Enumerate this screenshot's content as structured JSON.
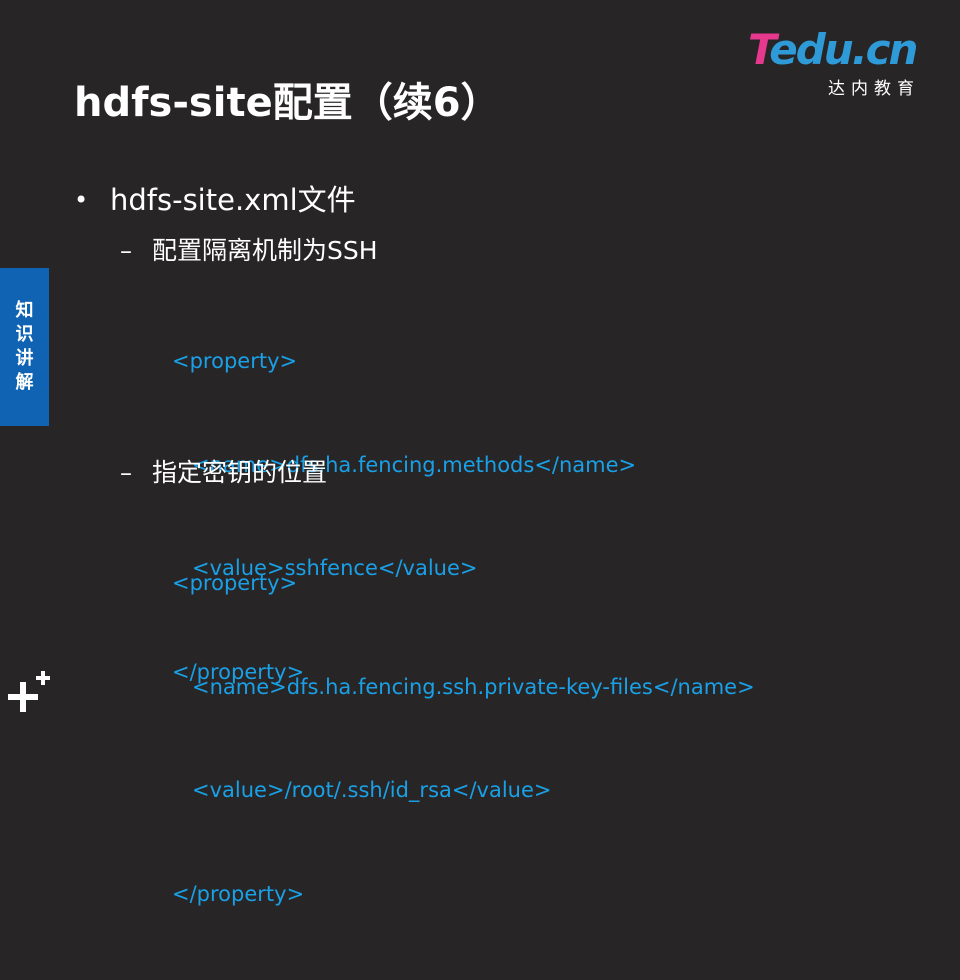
{
  "slide": {
    "title": "hdfs-site配置（续6）",
    "logo": {
      "brand_first": "T",
      "brand_rest": "edu.cn",
      "subtitle": "达内教育"
    },
    "side_tab": {
      "chars": [
        "知",
        "识",
        "讲",
        "解"
      ]
    },
    "bullet": {
      "marker": "•",
      "text": "hdfs-site.xml文件"
    },
    "sections": [
      {
        "dash": "–",
        "heading": "配置隔离机制为SSH",
        "code_lines": [
          "<property>",
          "   <name>dfs.ha.fencing.methods</name>",
          "   <value>sshfence</value>",
          "</property>"
        ]
      },
      {
        "dash": "–",
        "heading": "指定密钥的位置",
        "code_lines": [
          "<property>",
          "   <name>dfs.ha.fencing.ssh.private-key-files</name>",
          "   <value>/root/.ssh/id_rsa</value>",
          "</property>"
        ]
      }
    ],
    "colors": {
      "background": "#272526",
      "code": "#1aa0e6",
      "side_tab": "#0f63b2",
      "logo_pink": "#e6388c",
      "logo_blue": "#2f9ad8"
    },
    "icons": {
      "corner": "plus-plus-icon"
    }
  }
}
